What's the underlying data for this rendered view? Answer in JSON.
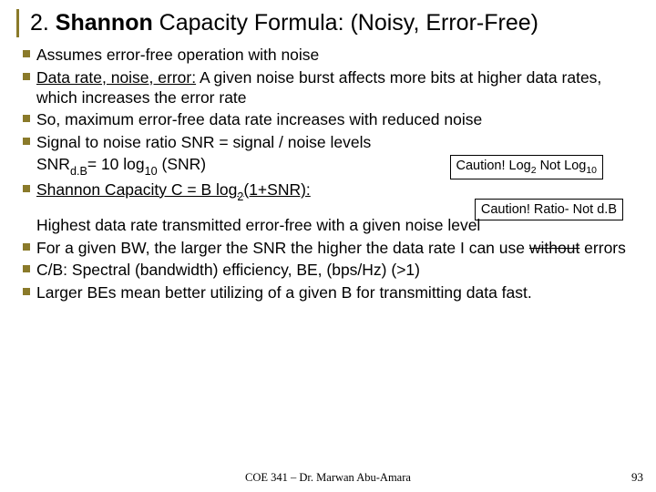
{
  "title_prefix": "2. ",
  "title_bold": "Shannon",
  "title_rest": " Capacity Formula: (Noisy, Error-Free)",
  "bullets1": {
    "b0": "Assumes error-free operation with noise",
    "b1_u": "Data rate, noise, error:",
    "b1_rest": " A given noise burst affects more bits at higher data rates, which increases the error rate",
    "b2": "So, maximum error-free data rate increases with reduced noise",
    "b3": "Signal to noise ratio SNR = signal / noise levels",
    "b3_line2_pre": "SNR",
    "b3_line2_sub": "d.B",
    "b3_line2_mid": "= 10 log",
    "b3_line2_sub2": "10",
    "b3_line2_post": " (SNR)",
    "b4_pre": "Shannon Capacity C = B log",
    "b4_sub": "2",
    "b4_post": "(1+SNR):"
  },
  "callout1_pre": "Caution! Log",
  "callout1_sub1": "2",
  "callout1_mid": " Not Log",
  "callout1_sub2": "10",
  "callout2": "Caution! Ratio- Not d.B",
  "mid_line": "Highest data rate transmitted error-free with a given noise level",
  "bullets2": {
    "b0_a": "For a given BW, the larger the SNR the higher the data rate I can use ",
    "b0_s": "without",
    "b0_b": " errors",
    "b1": "C/B: Spectral (bandwidth) efficiency, BE, (bps/Hz) (>1)",
    "b2": "Larger BEs mean better utilizing of a given B for transmitting data fast."
  },
  "footer": "COE 341 – Dr. Marwan Abu-Amara",
  "page": "93"
}
